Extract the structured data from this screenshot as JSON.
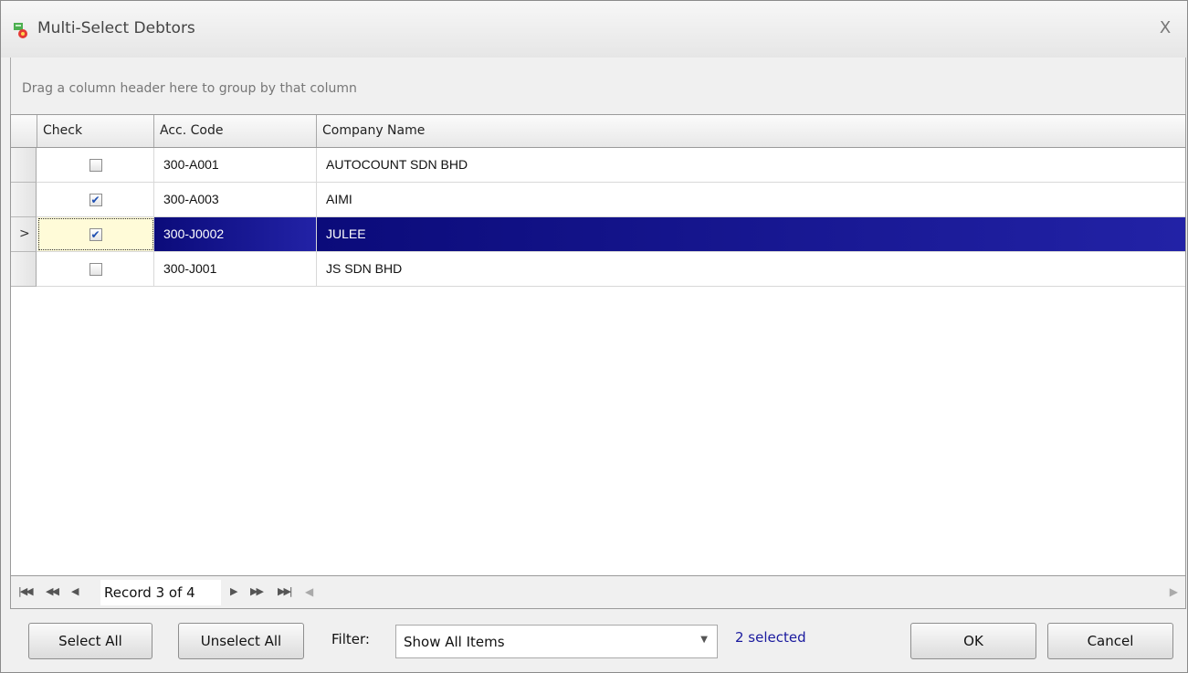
{
  "window": {
    "title": "Multi-Select Debtors",
    "close_glyph": "X"
  },
  "group_panel": {
    "hint": "Drag a column header here to group by that column"
  },
  "grid": {
    "columns": [
      "Check",
      "Acc. Code",
      "Company Name"
    ],
    "rows": [
      {
        "checked": false,
        "code": "300-A001",
        "name": "AUTOCOUNT SDN BHD",
        "selected": false
      },
      {
        "checked": true,
        "code": "300-A003",
        "name": "AIMI",
        "selected": false
      },
      {
        "checked": true,
        "code": "300-J0002",
        "name": "JULEE",
        "selected": true
      },
      {
        "checked": false,
        "code": "300-J001",
        "name": "JS SDN BHD",
        "selected": false
      }
    ]
  },
  "navigator": {
    "record_text": "Record 3 of 4"
  },
  "footer": {
    "select_all": "Select All",
    "unselect_all": "Unselect All",
    "filter_label": "Filter:",
    "filter_value": "Show All Items",
    "selected_count": "2 selected",
    "ok": "OK",
    "cancel": "Cancel"
  },
  "colors": {
    "selection": "#0b0b7a",
    "accent_text": "#1a1a9e"
  }
}
